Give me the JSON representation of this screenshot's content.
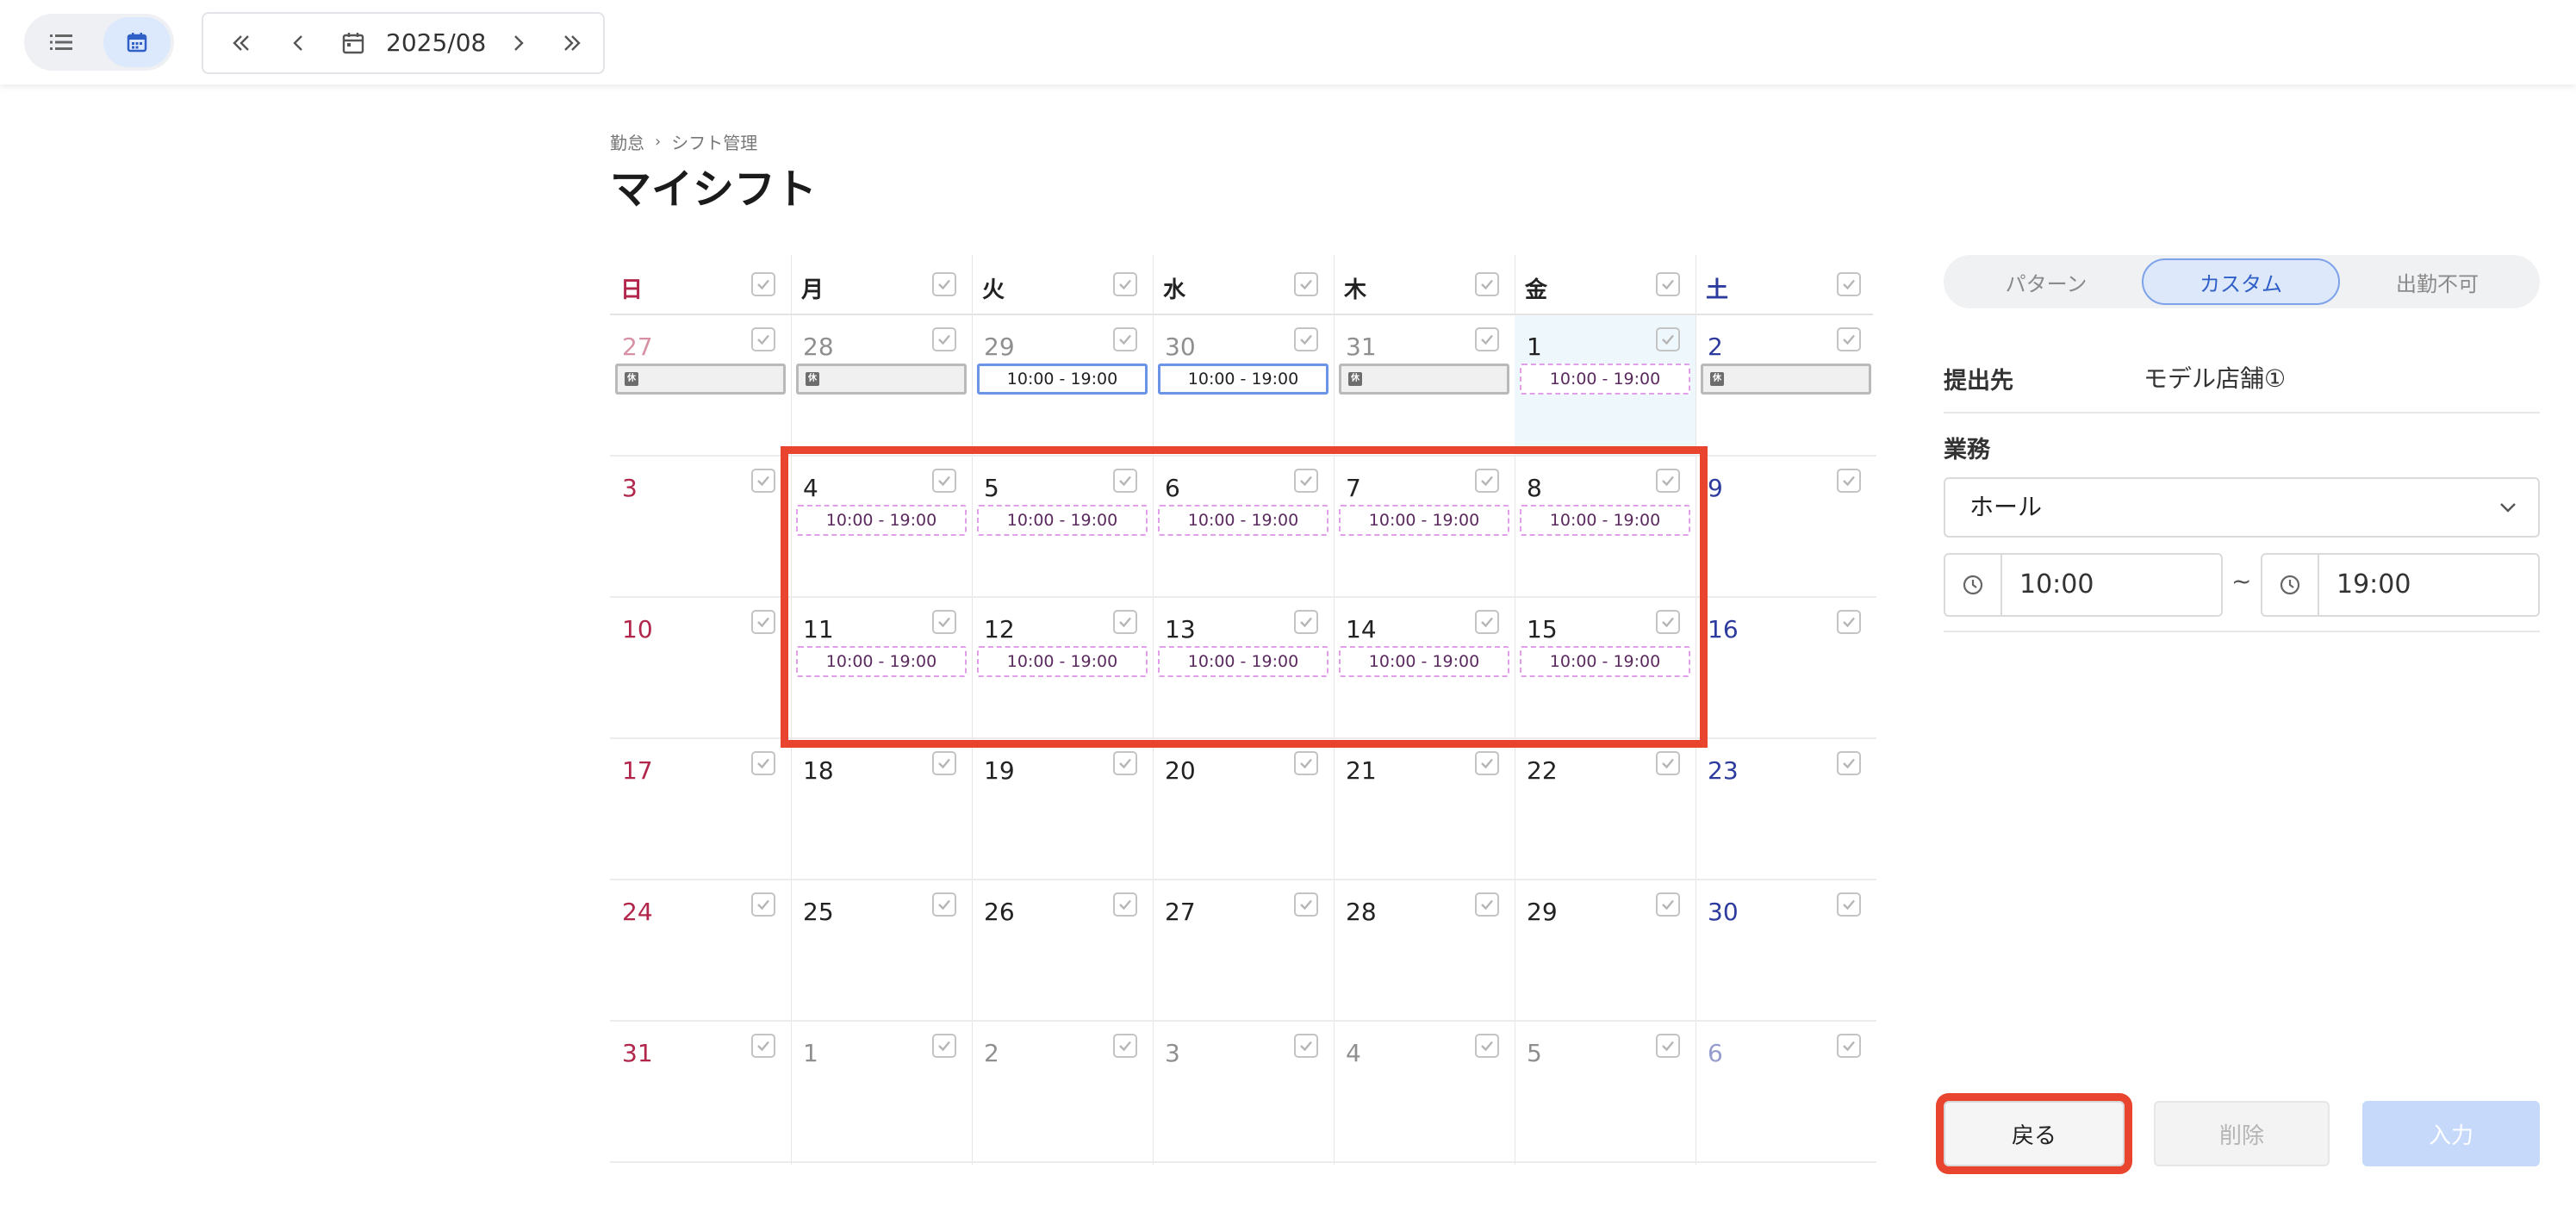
{
  "toolbar": {
    "month": "2025/08",
    "icons": [
      "list-icon",
      "calendar-icon",
      "double-chevron-left-icon",
      "chevron-left-icon",
      "calendar-icon",
      "chevron-right-icon",
      "double-chevron-right-icon"
    ]
  },
  "breadcrumb": {
    "items": [
      "勤怠",
      "シフト管理"
    ]
  },
  "page": {
    "title": "マイシフト"
  },
  "calendar": {
    "weekdays": [
      {
        "label": "日",
        "color": "#b3264b"
      },
      {
        "label": "月",
        "color": "#222222"
      },
      {
        "label": "火",
        "color": "#222222"
      },
      {
        "label": "水",
        "color": "#222222"
      },
      {
        "label": "木",
        "color": "#222222"
      },
      {
        "label": "金",
        "color": "#222222"
      },
      {
        "label": "土",
        "color": "#2d3b9e"
      }
    ],
    "weeks": [
      [
        {
          "day": "27",
          "muted": true,
          "shift": {
            "kind": "off",
            "text": "休"
          }
        },
        {
          "day": "28",
          "muted": true,
          "shift": {
            "kind": "off",
            "text": "休"
          }
        },
        {
          "day": "29",
          "muted": true,
          "shift": {
            "kind": "solid",
            "text": "10:00 - 19:00"
          }
        },
        {
          "day": "30",
          "muted": true,
          "shift": {
            "kind": "solid",
            "text": "10:00 - 19:00"
          }
        },
        {
          "day": "31",
          "muted": true,
          "shift": {
            "kind": "off",
            "text": "休"
          }
        },
        {
          "day": "1",
          "muted": false,
          "today": true,
          "shift": {
            "kind": "dashed",
            "text": "10:00 - 19:00"
          }
        },
        {
          "day": "2",
          "muted": false,
          "shift": {
            "kind": "off",
            "text": "休"
          }
        }
      ],
      [
        {
          "day": "3"
        },
        {
          "day": "4",
          "shift": {
            "kind": "dashed",
            "text": "10:00 - 19:00"
          }
        },
        {
          "day": "5",
          "shift": {
            "kind": "dashed",
            "text": "10:00 - 19:00"
          }
        },
        {
          "day": "6",
          "shift": {
            "kind": "dashed",
            "text": "10:00 - 19:00"
          }
        },
        {
          "day": "7",
          "shift": {
            "kind": "dashed",
            "text": "10:00 - 19:00"
          }
        },
        {
          "day": "8",
          "shift": {
            "kind": "dashed",
            "text": "10:00 - 19:00"
          }
        },
        {
          "day": "9"
        }
      ],
      [
        {
          "day": "10"
        },
        {
          "day": "11",
          "shift": {
            "kind": "dashed",
            "text": "10:00 - 19:00"
          }
        },
        {
          "day": "12",
          "shift": {
            "kind": "dashed",
            "text": "10:00 - 19:00"
          }
        },
        {
          "day": "13",
          "shift": {
            "kind": "dashed",
            "text": "10:00 - 19:00"
          }
        },
        {
          "day": "14",
          "shift": {
            "kind": "dashed",
            "text": "10:00 - 19:00"
          }
        },
        {
          "day": "15",
          "shift": {
            "kind": "dashed",
            "text": "10:00 - 19:00"
          }
        },
        {
          "day": "16"
        }
      ],
      [
        {
          "day": "17"
        },
        {
          "day": "18"
        },
        {
          "day": "19"
        },
        {
          "day": "20"
        },
        {
          "day": "21"
        },
        {
          "day": "22"
        },
        {
          "day": "23"
        }
      ],
      [
        {
          "day": "24"
        },
        {
          "day": "25"
        },
        {
          "day": "26"
        },
        {
          "day": "27"
        },
        {
          "day": "28"
        },
        {
          "day": "29"
        },
        {
          "day": "30"
        }
      ],
      [
        {
          "day": "31"
        },
        {
          "day": "1",
          "muted": true
        },
        {
          "day": "2",
          "muted": true
        },
        {
          "day": "3",
          "muted": true
        },
        {
          "day": "4",
          "muted": true
        },
        {
          "day": "5",
          "muted": true
        },
        {
          "day": "6",
          "muted": true
        }
      ]
    ]
  },
  "panel": {
    "tabs": [
      {
        "label": "パターン",
        "active": false
      },
      {
        "label": "カスタム",
        "active": true
      },
      {
        "label": "出勤不可",
        "active": false
      }
    ],
    "destination_label": "提出先",
    "destination_value": "モデル店舗①",
    "task_label": "業務",
    "task_value": "ホール",
    "start_time": "10:00",
    "end_time": "19:00",
    "time_separator": "~"
  },
  "actions": {
    "back": "戻る",
    "delete": "削除",
    "enter": "入力"
  },
  "colors": {
    "highlight": "#e8442e",
    "accent": "#2f5fc7",
    "sunday": "#b3264b",
    "saturday": "#2d3b9e"
  }
}
